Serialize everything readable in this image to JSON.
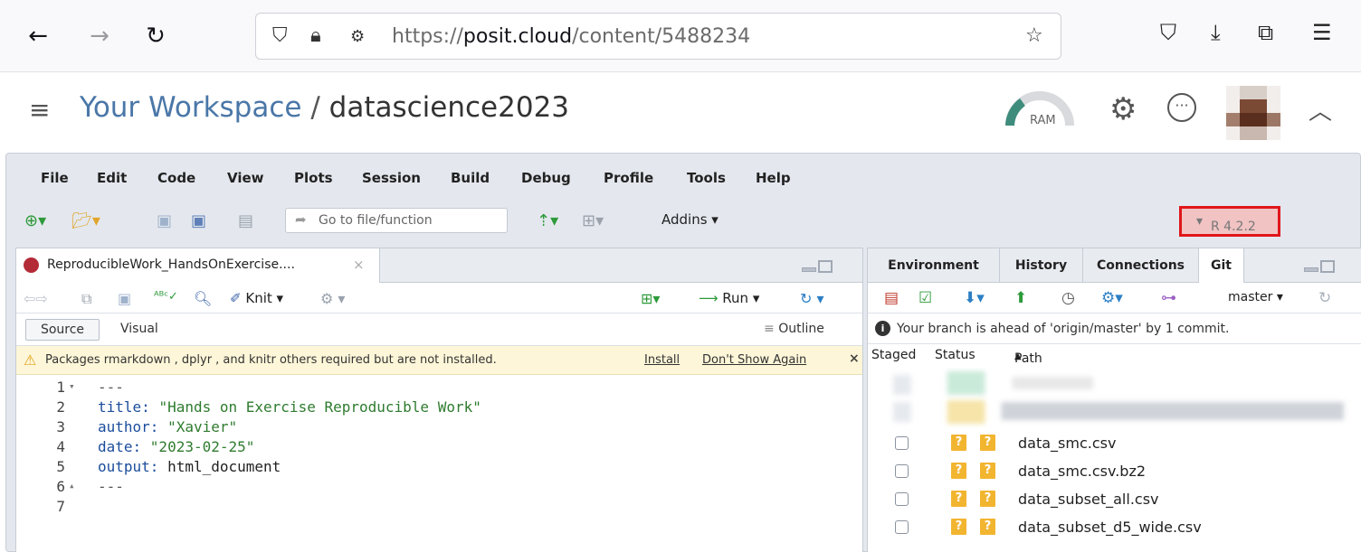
{
  "browser": {
    "url_prefix": "https://",
    "url_host": "posit.cloud",
    "url_path": "/content/5488234"
  },
  "workspace": {
    "breadcrumb_root": "Your Workspace",
    "separator": "/",
    "project_name": "datascience2023",
    "ram_label": "RAM"
  },
  "menu": [
    "File",
    "Edit",
    "Code",
    "View",
    "Plots",
    "Session",
    "Build",
    "Debug",
    "Profile",
    "Tools",
    "Help"
  ],
  "toolbar": {
    "goto_placeholder": "Go to file/function",
    "addins_label": "Addins",
    "r_version": "R 4.2.2"
  },
  "editor": {
    "tab_label": "ReproducibleWork_HandsOnExercise....",
    "knit_label": "Knit",
    "run_label": "Run",
    "source_label": "Source",
    "visual_label": "Visual",
    "outline_label": "Outline",
    "warning_text": "Packages rmarkdown , dplyr , and knitr others required but are not installed.",
    "warning_install": "Install",
    "warning_dismiss": "Don't Show Again",
    "lines": [
      {
        "n": "1",
        "fold": "▾",
        "parts": [
          {
            "c": "d",
            "t": "---"
          }
        ]
      },
      {
        "n": "2",
        "fold": "",
        "parts": [
          {
            "c": "k",
            "t": "title: "
          },
          {
            "c": "s",
            "t": "\"Hands on Exercise Reproducible Work\""
          }
        ]
      },
      {
        "n": "3",
        "fold": "",
        "parts": [
          {
            "c": "k",
            "t": "author: "
          },
          {
            "c": "s",
            "t": "\"Xavier\""
          }
        ]
      },
      {
        "n": "4",
        "fold": "",
        "parts": [
          {
            "c": "k",
            "t": "date: "
          },
          {
            "c": "s",
            "t": "\"2023-02-25\""
          }
        ]
      },
      {
        "n": "5",
        "fold": "",
        "parts": [
          {
            "c": "k",
            "t": "output: "
          },
          {
            "c": "p",
            "t": "html_document"
          }
        ]
      },
      {
        "n": "6",
        "fold": "▴",
        "parts": [
          {
            "c": "d",
            "t": "---"
          }
        ]
      },
      {
        "n": "7",
        "fold": "",
        "parts": []
      }
    ]
  },
  "git_pane": {
    "tabs": [
      "Environment",
      "History",
      "Connections",
      "Git"
    ],
    "active_tab": "Git",
    "branch": "master",
    "info": "Your branch is ahead of 'origin/master' by 1 commit.",
    "columns": {
      "staged": "Staged",
      "status": "Status",
      "path": "Path"
    },
    "files": [
      {
        "status1": "?",
        "status2": "?",
        "path": "data_smc.csv"
      },
      {
        "status1": "?",
        "status2": "?",
        "path": "data_smc.csv.bz2"
      },
      {
        "status1": "?",
        "status2": "?",
        "path": "data_subset_all.csv"
      },
      {
        "status1": "?",
        "status2": "?",
        "path": "data_subset_d5_wide.csv"
      }
    ]
  },
  "colors": {
    "accent_link": "#4a77a8",
    "highlight_border": "#e0161a",
    "highlight_fill": "#f1c3c3",
    "warning_bg": "#fdf6d8",
    "status_untracked": "#f2b530"
  }
}
